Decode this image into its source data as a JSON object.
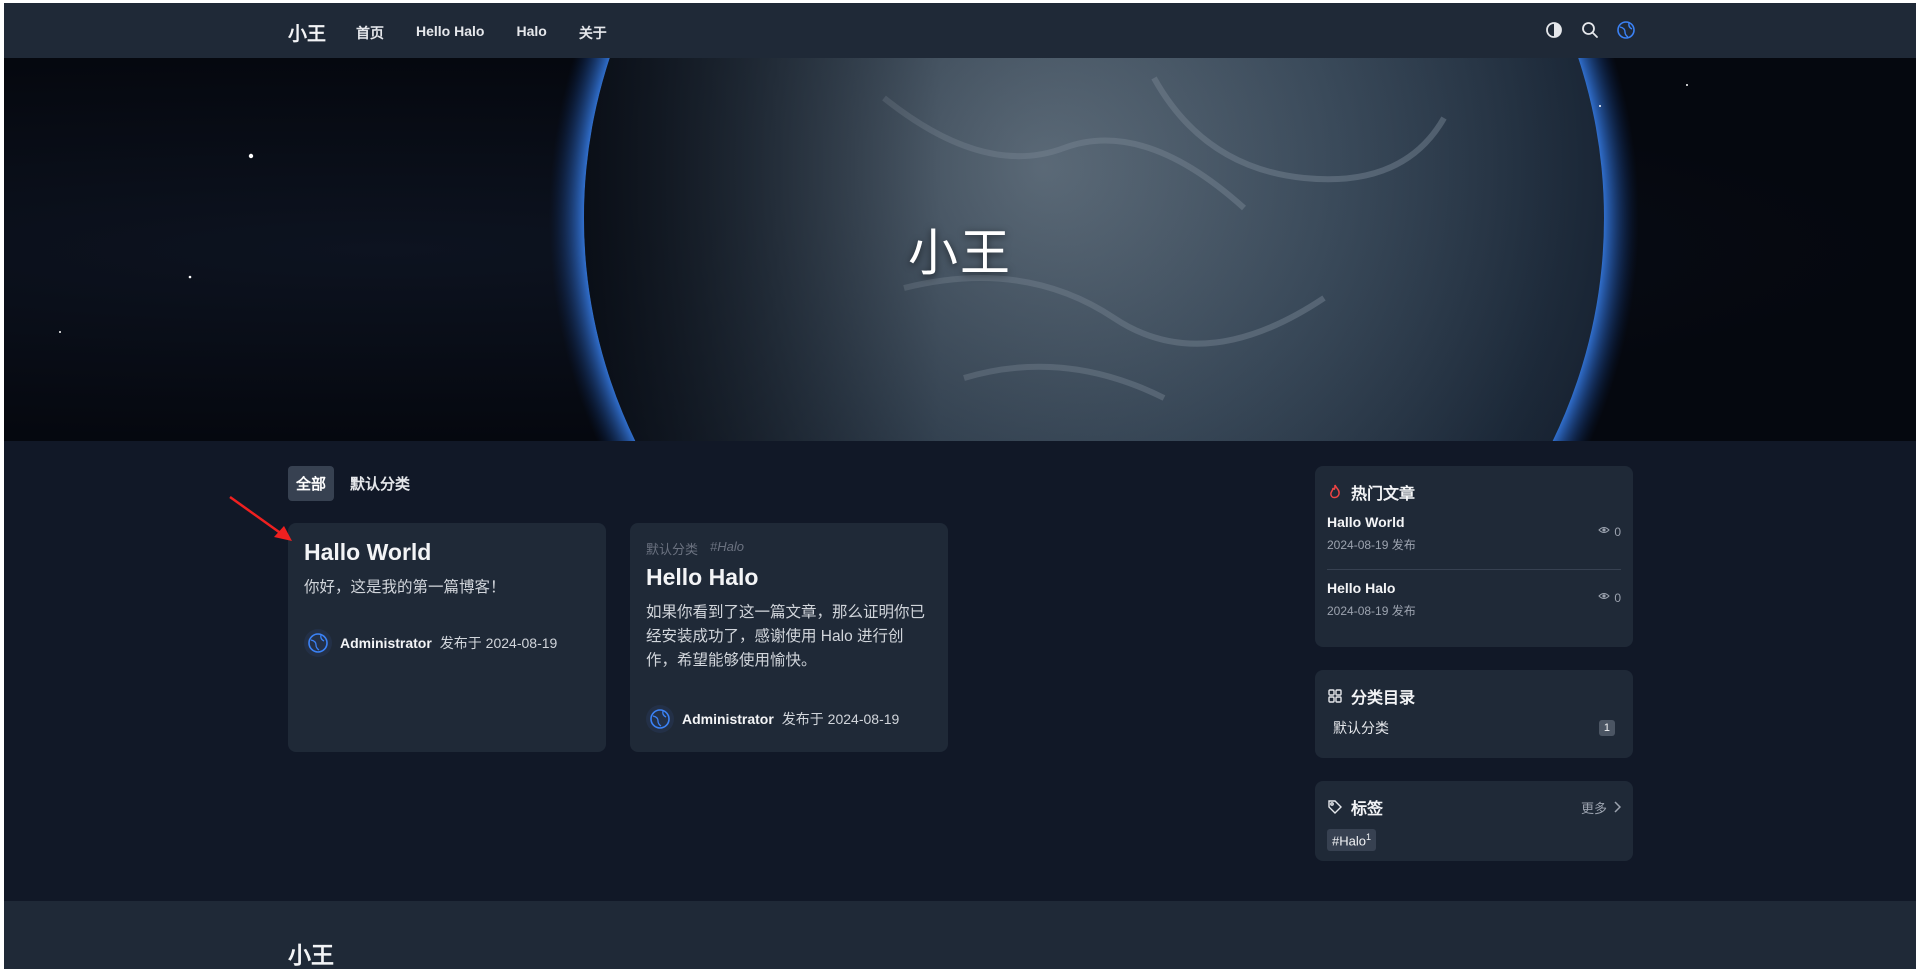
{
  "header": {
    "brand": "小王",
    "nav": [
      "首页",
      "Hello Halo",
      "Halo",
      "关于"
    ],
    "icons": [
      "theme-toggle-icon",
      "search-icon",
      "halo-logo-icon"
    ]
  },
  "hero": {
    "title": "小王"
  },
  "categories": {
    "tabs": [
      "全部",
      "默认分类"
    ],
    "active": "全部"
  },
  "posts": [
    {
      "category": "",
      "tag": "",
      "title": "Hallo World",
      "excerpt": "你好，这是我的第一篇博客！",
      "author": "Administrator",
      "published": "发布于 2024-08-19"
    },
    {
      "category": "默认分类",
      "tag": "#Halo",
      "title": "Hello Halo",
      "excerpt": "如果你看到了这一篇文章，那么证明你已经安装成功了，感谢使用 Halo 进行创作，希望能够使用愉快。",
      "author": "Administrator",
      "published": "发布于 2024-08-19"
    }
  ],
  "sidebar": {
    "hot": {
      "title": "热门文章",
      "items": [
        {
          "title": "Hallo World",
          "date": "2024-08-19 发布",
          "views": "0"
        },
        {
          "title": "Hello Halo",
          "date": "2024-08-19 发布",
          "views": "0"
        }
      ]
    },
    "categories": {
      "title": "分类目录",
      "items": [
        {
          "name": "默认分类",
          "count": "1"
        }
      ]
    },
    "tags": {
      "title": "标签",
      "more": "更多",
      "items": [
        {
          "name": "#Halo",
          "count": "1"
        }
      ]
    }
  },
  "footer": {
    "brand": "小王"
  },
  "colors": {
    "accent": "#3b82f6",
    "background": "#111827",
    "card": "#1f2937",
    "annotation_arrow": "#ef2020"
  }
}
